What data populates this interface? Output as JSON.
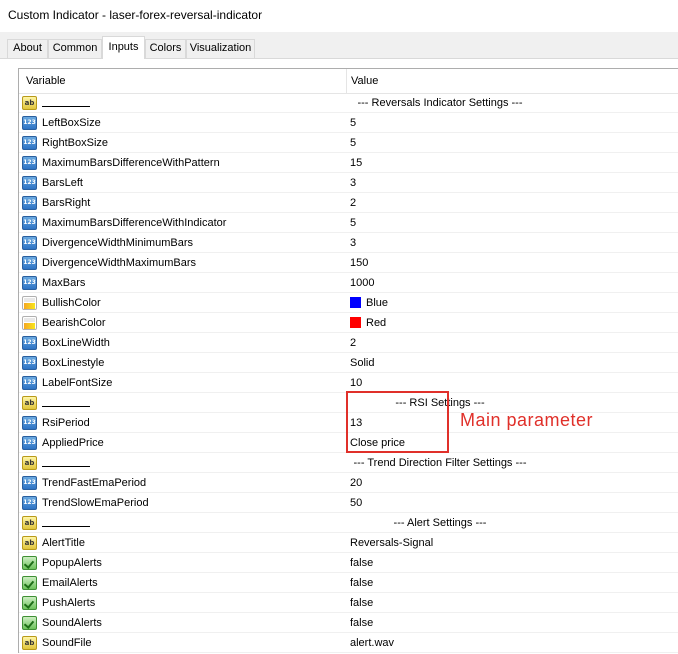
{
  "window": {
    "title": "Custom Indicator - laser-forex-reversal-indicator"
  },
  "tabs": [
    {
      "label": "About",
      "active": false
    },
    {
      "label": "Common",
      "active": false
    },
    {
      "label": "Inputs",
      "active": true
    },
    {
      "label": "Colors",
      "active": false
    },
    {
      "label": "Visualization",
      "active": false
    }
  ],
  "grid": {
    "columns": {
      "variable": "Variable",
      "value": "Value"
    },
    "rows": [
      {
        "type": "string",
        "name": "",
        "value": "--- Reversals Indicator Settings ---"
      },
      {
        "type": "int",
        "name": "LeftBoxSize",
        "value": "5"
      },
      {
        "type": "int",
        "name": "RightBoxSize",
        "value": "5"
      },
      {
        "type": "int",
        "name": "MaximumBarsDifferenceWithPattern",
        "value": "15"
      },
      {
        "type": "int",
        "name": "BarsLeft",
        "value": "3"
      },
      {
        "type": "int",
        "name": "BarsRight",
        "value": "2"
      },
      {
        "type": "int",
        "name": "MaximumBarsDifferenceWithIndicator",
        "value": "5"
      },
      {
        "type": "int",
        "name": "DivergenceWidthMinimumBars",
        "value": "3"
      },
      {
        "type": "int",
        "name": "DivergenceWidthMaximumBars",
        "value": "150"
      },
      {
        "type": "int",
        "name": "MaxBars",
        "value": "1000"
      },
      {
        "type": "color",
        "name": "BullishColor",
        "value": "Blue",
        "swatch": "#0000ff"
      },
      {
        "type": "color",
        "name": "BearishColor",
        "value": "Red",
        "swatch": "#ff0000"
      },
      {
        "type": "int",
        "name": "BoxLineWidth",
        "value": "2"
      },
      {
        "type": "int",
        "name": "BoxLinestyle",
        "value": "Solid"
      },
      {
        "type": "int",
        "name": "LabelFontSize",
        "value": "10"
      },
      {
        "type": "string",
        "name": "",
        "value": "--- RSI Settings ---"
      },
      {
        "type": "int",
        "name": "RsiPeriod",
        "value": "13"
      },
      {
        "type": "int",
        "name": "AppliedPrice",
        "value": "Close price"
      },
      {
        "type": "string",
        "name": "",
        "value": "--- Trend Direction Filter Settings ---"
      },
      {
        "type": "int",
        "name": "TrendFastEmaPeriod",
        "value": "20"
      },
      {
        "type": "int",
        "name": "TrendSlowEmaPeriod",
        "value": "50"
      },
      {
        "type": "string",
        "name": "",
        "value": "--- Alert Settings ---"
      },
      {
        "type": "string",
        "name": "AlertTitle",
        "value": "Reversals-Signal"
      },
      {
        "type": "bool",
        "name": "PopupAlerts",
        "value": "false"
      },
      {
        "type": "bool",
        "name": "EmailAlerts",
        "value": "false"
      },
      {
        "type": "bool",
        "name": "PushAlerts",
        "value": "false"
      },
      {
        "type": "bool",
        "name": "SoundAlerts",
        "value": "false"
      },
      {
        "type": "string",
        "name": "SoundFile",
        "value": "alert.wav"
      }
    ]
  },
  "annotation": {
    "text": "Main parameter",
    "color": "#e0302a"
  }
}
